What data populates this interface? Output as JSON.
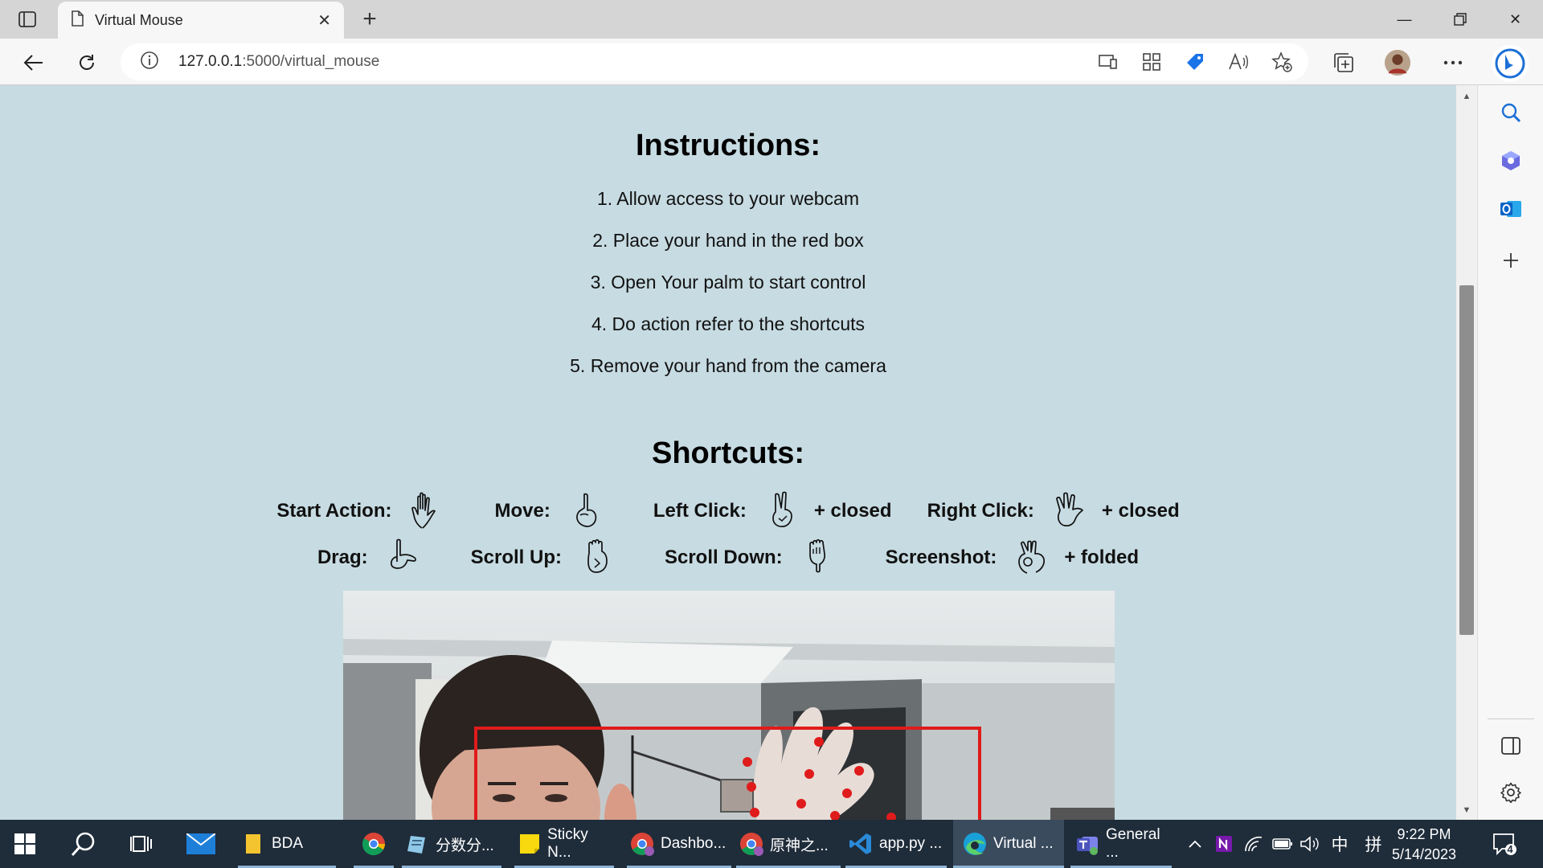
{
  "browser": {
    "tab_title": "Virtual Mouse",
    "url_host": "127.0.0.1",
    "url_path": ":5000/virtual_mouse"
  },
  "page": {
    "instructions_title": "Instructions:",
    "instructions": [
      "1. Allow access to your webcam",
      "2. Place your hand in the red box",
      "3. Open Your palm to start control",
      "4. Do action refer to the shortcuts",
      "5. Remove your hand from the camera"
    ],
    "shortcuts_title": "Shortcuts:",
    "shortcuts_row1": [
      {
        "label": "Start Action:",
        "suffix": "",
        "icon": "open-palm-icon"
      },
      {
        "label": "Move:",
        "suffix": "",
        "icon": "index-finger-icon"
      },
      {
        "label": "Left Click:",
        "suffix": "+ closed",
        "icon": "two-finger-icon"
      },
      {
        "label": "Right Click:",
        "suffix": "+ closed",
        "icon": "three-finger-icon"
      }
    ],
    "shortcuts_row2": [
      {
        "label": "Drag:",
        "suffix": "",
        "icon": "pointing-hand-icon"
      },
      {
        "label": "Scroll Up:",
        "suffix": "",
        "icon": "fist-up-icon"
      },
      {
        "label": "Scroll Down:",
        "suffix": "",
        "icon": "fist-down-icon"
      },
      {
        "label": "Screenshot:",
        "suffix": "+ folded",
        "icon": "ok-hand-icon"
      }
    ]
  },
  "taskbar": {
    "items": [
      {
        "label": "BDA",
        "icon": "folder-icon"
      },
      {
        "label": "",
        "icon": "chrome-icon"
      },
      {
        "label": "分数分...",
        "icon": "notepad-icon"
      },
      {
        "label": "Sticky N...",
        "icon": "sticky-notes-icon"
      },
      {
        "label": "Dashbo...",
        "icon": "chrome-profile-icon"
      },
      {
        "label": "原神之...",
        "icon": "chrome-profile-icon"
      },
      {
        "label": "app.py ...",
        "icon": "vscode-icon"
      },
      {
        "label": "Virtual ...",
        "icon": "edge-icon"
      },
      {
        "label": "General ...",
        "icon": "teams-icon"
      }
    ],
    "time": "9:22 PM",
    "date": "5/14/2023",
    "ime_lang": "中",
    "ime_mode": "拼",
    "notification_count": "4"
  },
  "colors": {
    "page_bg": "#c7dbe2",
    "taskbar_bg": "#1f2c3a",
    "red_box": "#e01b1b"
  }
}
